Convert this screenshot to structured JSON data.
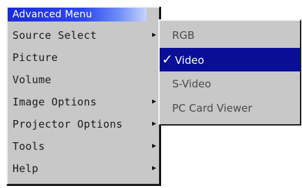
{
  "menu": {
    "title": "Advanced Menu",
    "items": [
      {
        "label": "Source Select",
        "has_submenu": true
      },
      {
        "label": "Picture",
        "has_submenu": false
      },
      {
        "label": "Volume",
        "has_submenu": false
      },
      {
        "label": "Image Options",
        "has_submenu": true
      },
      {
        "label": "Projector Options",
        "has_submenu": true
      },
      {
        "label": "Tools",
        "has_submenu": true
      },
      {
        "label": "Help",
        "has_submenu": true
      }
    ]
  },
  "submenu": {
    "items": [
      {
        "label": "RGB",
        "selected": false
      },
      {
        "label": "Video",
        "selected": true
      },
      {
        "label": "S-Video",
        "selected": false
      },
      {
        "label": "PC Card Viewer",
        "selected": false
      }
    ],
    "check_glyph": "✓"
  },
  "icons": {
    "submenu_arrow": "▶"
  },
  "colors": {
    "title_bar": "#2f47ee",
    "selection": "#0a0e96",
    "menu_background": "#c8c8c8"
  }
}
